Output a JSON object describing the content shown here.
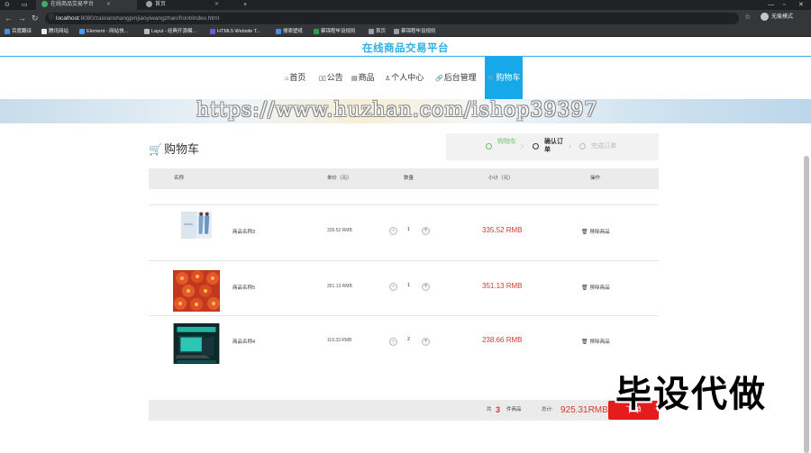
{
  "browser": {
    "tabs": [
      {
        "title": "在线商品交易平台",
        "active": true
      },
      {
        "title": "首页",
        "active": false
      }
    ],
    "new_tab": "+",
    "win_controls": [
      "—",
      "▫",
      "✕"
    ],
    "url_host": "localhost",
    "url_path": ":8080/zaixianshangpinjiaoyiwangzhan/front/index.html",
    "profile_label": "无痕模式",
    "bookmarks": [
      "百度翻译",
      "腾讯网站",
      "Element - 网站快...",
      "Layui - 经典开源模...",
      "HTML5 Website T...",
      "搜索壁纸",
      "蔡锦程毕设规则",
      "首页",
      "蔡锦程毕设规则"
    ]
  },
  "site": {
    "title": "在线商品交易平台",
    "menu": [
      {
        "icon": "⌂",
        "label": "首页"
      },
      {
        "icon": "▯▯",
        "label": "公告"
      },
      {
        "icon": "▤",
        "label": "商品"
      },
      {
        "icon": "♙",
        "label": "个人中心"
      },
      {
        "icon": "🔗",
        "label": "后台管理"
      },
      {
        "icon": "🛒",
        "label": "购物车",
        "active": true
      }
    ],
    "watermark": "https://www.huzhan.com/ishop39397"
  },
  "cart": {
    "heading": "购物车",
    "steps": [
      {
        "label": "购物车",
        "state": "done"
      },
      {
        "label": "确认订单",
        "state": "current"
      },
      {
        "label": "完成订单",
        "state": "pending"
      }
    ],
    "columns": [
      "名称",
      "单价（元）",
      "数量",
      "小计（元）",
      "操作"
    ],
    "items": [
      {
        "name": "商品名称3",
        "price": "335.52 RMB",
        "qty": "1",
        "subtotal": "335.52 RMB",
        "action": "移除商品",
        "thumb": "dress-photo"
      },
      {
        "name": "商品名称5",
        "price": "351.13 RMB",
        "qty": "1",
        "subtotal": "351.13 RMB",
        "action": "移除商品",
        "thumb": "food-photo"
      },
      {
        "name": "商品名称4",
        "price": "119.33 RMB",
        "qty": "2",
        "subtotal": "238.66 RMB",
        "action": "移除商品",
        "thumb": "laptop-photo"
      }
    ],
    "minus": "-",
    "plus": "+",
    "footer": {
      "prefix": "共",
      "count": "3",
      "suffix": "件商品",
      "total_label": "总计:",
      "total": "925.31RMB",
      "order_button": "下单"
    }
  },
  "overlay": {
    "text": "毕设代做"
  },
  "colors": {
    "accent": "#17a8ea",
    "price": "#d43a2e",
    "order_button": "#e51c1c"
  }
}
